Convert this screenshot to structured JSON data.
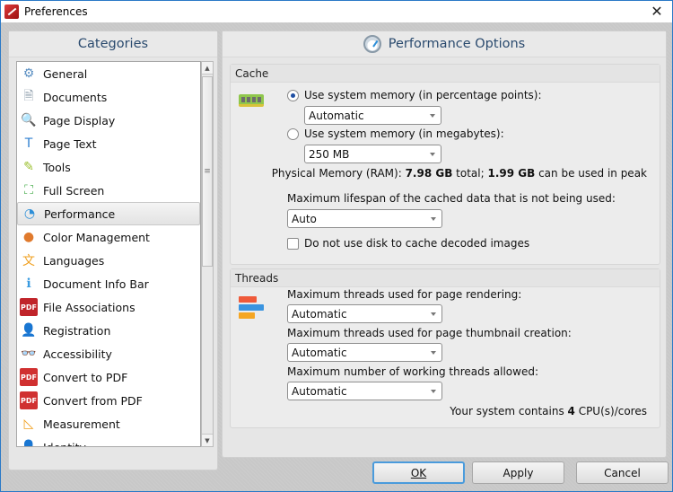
{
  "window": {
    "title": "Preferences",
    "close_label": "✕"
  },
  "categories": {
    "header": "Categories",
    "items": [
      {
        "label": "General",
        "icon": "general-settings-icon",
        "glyph": "⚙",
        "color": "#5a8fc2",
        "selected": false
      },
      {
        "label": "Documents",
        "icon": "documents-icon",
        "glyph": "🗎",
        "color": "#8a9aa8",
        "selected": false
      },
      {
        "label": "Page Display",
        "icon": "page-display-icon",
        "glyph": "🔍",
        "color": "#3a8fd8",
        "selected": false
      },
      {
        "label": "Page Text",
        "icon": "page-text-icon",
        "glyph": "T",
        "color": "#2d7fd0",
        "selected": false
      },
      {
        "label": "Tools",
        "icon": "tools-icon",
        "glyph": "✎",
        "color": "#9bbf2e",
        "selected": false
      },
      {
        "label": "Full Screen",
        "icon": "full-screen-icon",
        "glyph": "⛶",
        "color": "#4caf50",
        "selected": false
      },
      {
        "label": "Performance",
        "icon": "performance-gauge-icon",
        "glyph": "◔",
        "color": "#2d8fd8",
        "selected": true
      },
      {
        "label": "Color Management",
        "icon": "color-wheel-icon",
        "glyph": "●",
        "color": "#e07a2d",
        "selected": false
      },
      {
        "label": "Languages",
        "icon": "languages-icon",
        "glyph": "文",
        "color": "#f0a020",
        "selected": false
      },
      {
        "label": "Document Info Bar",
        "icon": "info-icon",
        "glyph": "ℹ",
        "color": "#3a9be0",
        "selected": false
      },
      {
        "label": "File Associations",
        "icon": "pdf-file-icon",
        "glyph": "PDF",
        "color": "#c0242a",
        "selected": false
      },
      {
        "label": "Registration",
        "icon": "registration-user-icon",
        "glyph": "👤",
        "color": "#3a8fd8",
        "selected": false
      },
      {
        "label": "Accessibility",
        "icon": "glasses-icon",
        "glyph": "👓",
        "color": "#6a8aa8",
        "selected": false
      },
      {
        "label": "Convert to PDF",
        "icon": "convert-to-pdf-icon",
        "glyph": "PDF",
        "color": "#d03030",
        "selected": false
      },
      {
        "label": "Convert from PDF",
        "icon": "convert-from-pdf-icon",
        "glyph": "PDF",
        "color": "#d03030",
        "selected": false
      },
      {
        "label": "Measurement",
        "icon": "triangle-ruler-icon",
        "glyph": "◺",
        "color": "#f0a020",
        "selected": false
      },
      {
        "label": "Identity",
        "icon": "identity-icon",
        "glyph": "👤",
        "color": "#c07850",
        "selected": false
      }
    ]
  },
  "options": {
    "header": "Performance Options",
    "cache": {
      "title": "Cache",
      "radio_percent_label": "Use system memory (in percentage points):",
      "radio_percent_checked": true,
      "percent_value": "Automatic",
      "radio_mb_label": "Use system memory (in megabytes):",
      "radio_mb_checked": false,
      "mb_value": "250 MB",
      "physical_prefix": "Physical Memory (RAM): ",
      "physical_total": "7.98 GB",
      "physical_mid": " total; ",
      "physical_peak": "1.99 GB",
      "physical_suffix": " can be used in peak",
      "lifespan_label": "Maximum lifespan of the cached data that is not being used:",
      "lifespan_value": "Auto",
      "disk_checkbox_label": "Do not use disk to cache decoded images",
      "disk_checkbox_checked": false
    },
    "threads": {
      "title": "Threads",
      "rendering_label": "Maximum threads used for page rendering:",
      "rendering_value": "Automatic",
      "thumbnail_label": "Maximum threads used for page thumbnail creation:",
      "thumbnail_value": "Automatic",
      "working_label": "Maximum number of working threads allowed:",
      "working_value": "Automatic",
      "cpu_prefix": "Your system contains ",
      "cpu_count": "4",
      "cpu_suffix": " CPU(s)/cores"
    }
  },
  "buttons": {
    "ok": "OK",
    "apply": "Apply",
    "cancel": "Cancel"
  }
}
